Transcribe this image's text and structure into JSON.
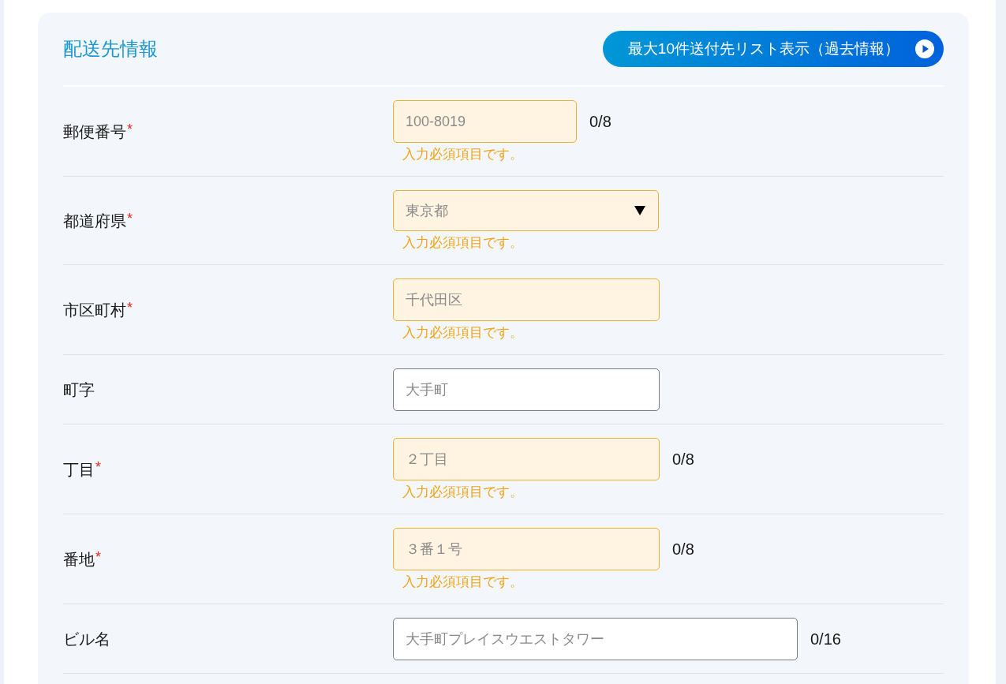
{
  "section": {
    "title": "配送先情報",
    "history_button": {
      "label": "最大10件送付先リスト表示（過去情報）"
    }
  },
  "fields": [
    {
      "kind": "text",
      "label": "郵便番号",
      "required_mark": "*",
      "placeholder": "100-8019",
      "invalid": true,
      "counter": "0/8",
      "error_message": "入力必須項目です。"
    },
    {
      "kind": "select",
      "label": "都道府県",
      "required_mark": "*",
      "placeholder": "東京都",
      "invalid": true,
      "error_message": "入力必須項目です。"
    },
    {
      "kind": "text",
      "label": "市区町村",
      "required_mark": "*",
      "placeholder": "千代田区",
      "invalid": true,
      "error_message": "入力必須項目です。"
    },
    {
      "kind": "text",
      "label": "町字",
      "placeholder": "大手町",
      "invalid": false
    },
    {
      "kind": "text",
      "label": "丁目",
      "required_mark": "*",
      "placeholder": "２丁目",
      "invalid": true,
      "counter": "0/8",
      "error_message": "入力必須項目です。"
    },
    {
      "kind": "text",
      "label": "番地",
      "required_mark": "*",
      "placeholder": "３番１号",
      "invalid": true,
      "counter": "0/8",
      "error_message": "入力必須項目です。"
    },
    {
      "kind": "text",
      "label": "ビル名",
      "placeholder": "大手町プレイスウエストタワー",
      "invalid": false,
      "counter": "0/16"
    }
  ]
}
